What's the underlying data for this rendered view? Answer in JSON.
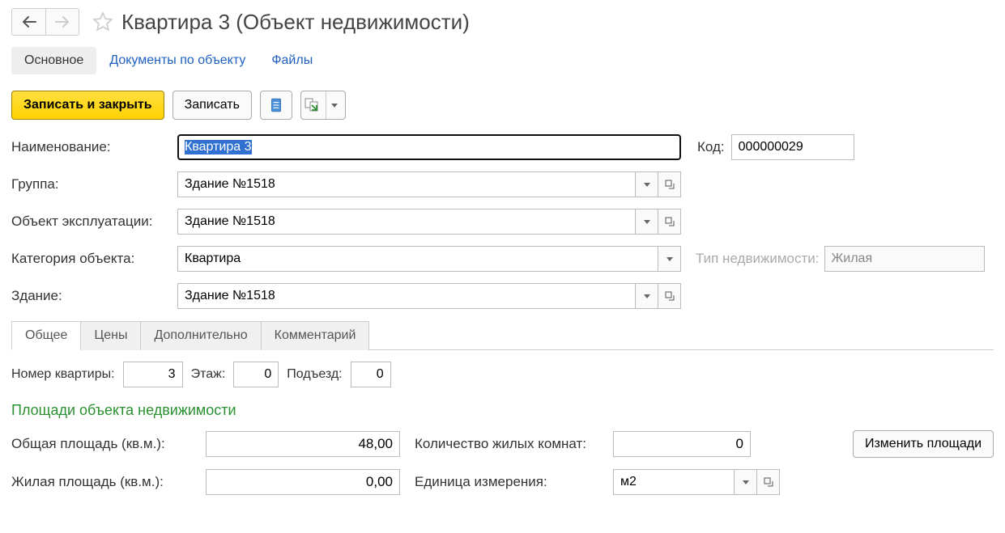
{
  "header": {
    "title": "Квартира 3 (Объект недвижимости)"
  },
  "nav_tabs": {
    "main": "Основное",
    "docs": "Документы по объекту",
    "files": "Файлы"
  },
  "toolbar": {
    "save_close": "Записать и закрыть",
    "save": "Записать"
  },
  "fields": {
    "name_label": "Наименование:",
    "name_value": "Квартира 3",
    "code_label": "Код:",
    "code_value": "000000029",
    "group_label": "Группа:",
    "group_value": "Здание №1518",
    "exploit_label": "Объект эксплуатации:",
    "exploit_value": "Здание №1518",
    "category_label": "Категория объекта:",
    "category_value": "Квартира",
    "realty_type_label": "Тип недвижимости:",
    "realty_type_value": "Жилая",
    "building_label": "Здание:",
    "building_value": "Здание №1518"
  },
  "sub_tabs": {
    "general": "Общее",
    "prices": "Цены",
    "additional": "Дополнительно",
    "comment": "Комментарий"
  },
  "general": {
    "apt_no_label": "Номер квартиры:",
    "apt_no_value": "3",
    "floor_label": "Этаж:",
    "floor_value": "0",
    "entrance_label": "Подъезд:",
    "entrance_value": "0",
    "areas_title": "Площади объекта недвижимости",
    "total_area_label": "Общая площадь (кв.м.):",
    "total_area_value": "48,00",
    "rooms_label": "Количество жилых комнат:",
    "rooms_value": "0",
    "change_areas_btn": "Изменить площади",
    "living_area_label": "Жилая площадь (кв.м.):",
    "living_area_value": "0,00",
    "unit_label": "Единица измерения:",
    "unit_value": "м2"
  }
}
